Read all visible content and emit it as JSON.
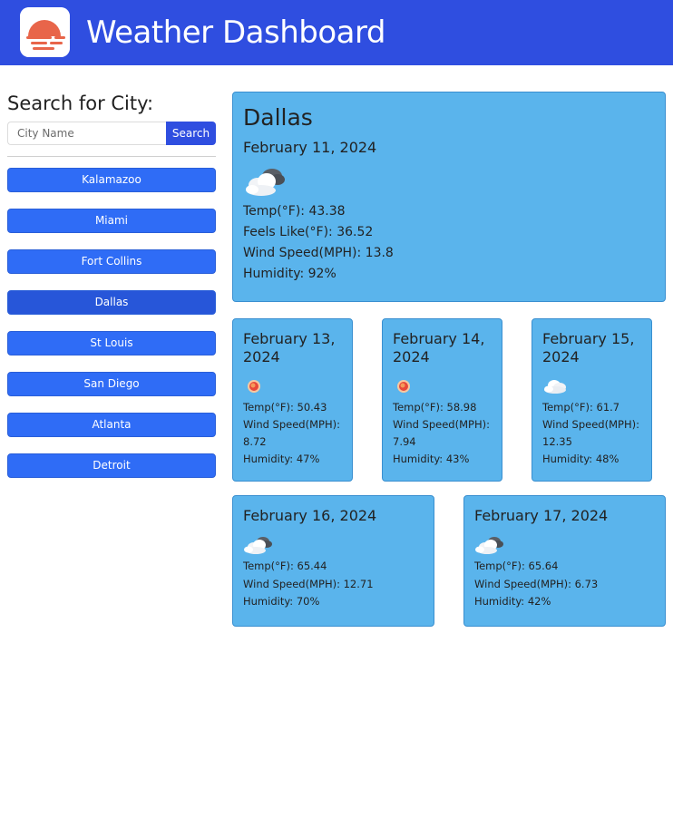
{
  "header": {
    "title": "Weather Dashboard",
    "logo_icon": "sunset-icon",
    "background_color": "#2f4ee0"
  },
  "search": {
    "heading": "Search for City:",
    "placeholder": "City Name",
    "value": "",
    "button_label": "Search"
  },
  "history": {
    "cities": [
      "Kalamazoo",
      "Miami",
      "Fort Collins",
      "Dallas",
      "St Louis",
      "San Diego",
      "Atlanta",
      "Detroit"
    ],
    "button_color": "#2f6cf6"
  },
  "current": {
    "city": "Dallas",
    "date": "February 11, 2024",
    "icon": "partly-cloudy-icon",
    "temp": "Temp(°F): 43.38",
    "feels_like": "Feels Like(°F): 36.52",
    "wind": "Wind Speed(MPH): 13.8",
    "humidity": "Humidity: 92%"
  },
  "forecast": [
    {
      "date": "February 13, 2024",
      "icon": "sun-icon",
      "temp": "Temp(°F): 50.43",
      "wind": "Wind Speed(MPH): 8.72",
      "humidity": "Humidity: 47%"
    },
    {
      "date": "February 14, 2024",
      "icon": "sun-icon",
      "temp": "Temp(°F): 58.98",
      "wind": "Wind Speed(MPH): 7.94",
      "humidity": "Humidity: 43%"
    },
    {
      "date": "February 15, 2024",
      "icon": "cloud-icon",
      "temp": "Temp(°F): 61.7",
      "wind": "Wind Speed(MPH): 12.35",
      "humidity": "Humidity: 48%"
    },
    {
      "date": "February 16, 2024",
      "icon": "partly-cloudy-icon",
      "temp": "Temp(°F): 65.44",
      "wind": "Wind Speed(MPH): 12.71",
      "humidity": "Humidity: 70%"
    },
    {
      "date": "February 17, 2024",
      "icon": "partly-cloudy-icon",
      "temp": "Temp(°F): 65.64",
      "wind": "Wind Speed(MPH): 6.73",
      "humidity": "Humidity: 42%"
    }
  ],
  "colors": {
    "card_background": "#5ab4ec",
    "card_border": "#3a8fd0"
  }
}
